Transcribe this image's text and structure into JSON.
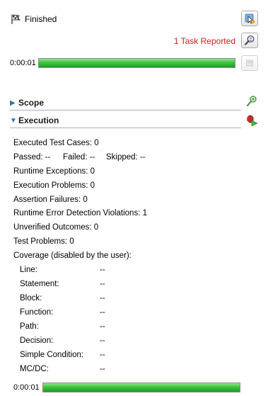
{
  "header": {
    "status": "Finished",
    "task_reported": "1 Task Reported"
  },
  "progress_top": {
    "time": "0:00:01",
    "fraction": 1.0
  },
  "sections": {
    "scope": "Scope",
    "execution": "Execution"
  },
  "execution": {
    "executed_test_cases": "Executed Test Cases: 0",
    "passed": "Passed:  --",
    "failed": "Failed: --",
    "skipped": "Skipped: --",
    "runtime_exceptions": "Runtime Exceptions: 0",
    "execution_problems": "Execution Problems: 0",
    "assertion_failures": "Assertion Failures: 0",
    "runtime_error_detection": "Runtime Error Detection Violations: 1",
    "unverified_outcomes": "Unverified Outcomes: 0",
    "test_problems": "Test Problems: 0",
    "coverage_header": "Coverage (disabled by the user):",
    "coverage": [
      {
        "label": "Line:",
        "value": "--"
      },
      {
        "label": "Statement:",
        "value": "--"
      },
      {
        "label": "Block:",
        "value": "--"
      },
      {
        "label": "Function:",
        "value": "--"
      },
      {
        "label": "Path:",
        "value": "--"
      },
      {
        "label": "Decision:",
        "value": "--"
      },
      {
        "label": "Simple Condition:",
        "value": "--"
      },
      {
        "label": "MC/DC:",
        "value": "--"
      }
    ]
  },
  "progress_bottom": {
    "time": "0:00:01",
    "fraction": 1.0
  },
  "colors": {
    "progress_green": "#3bc43b",
    "task_reported_red": "#cc1f1f",
    "section_blue": "#3a6ea5"
  },
  "icons": {
    "status": "checkered-flag-icon",
    "go_to_tests": "arrow-cursor-icon",
    "task_reported": "magnifier-person-icon",
    "stop": "stop-icon",
    "scope": "scope-icon",
    "execution": "bug-run-icon"
  }
}
